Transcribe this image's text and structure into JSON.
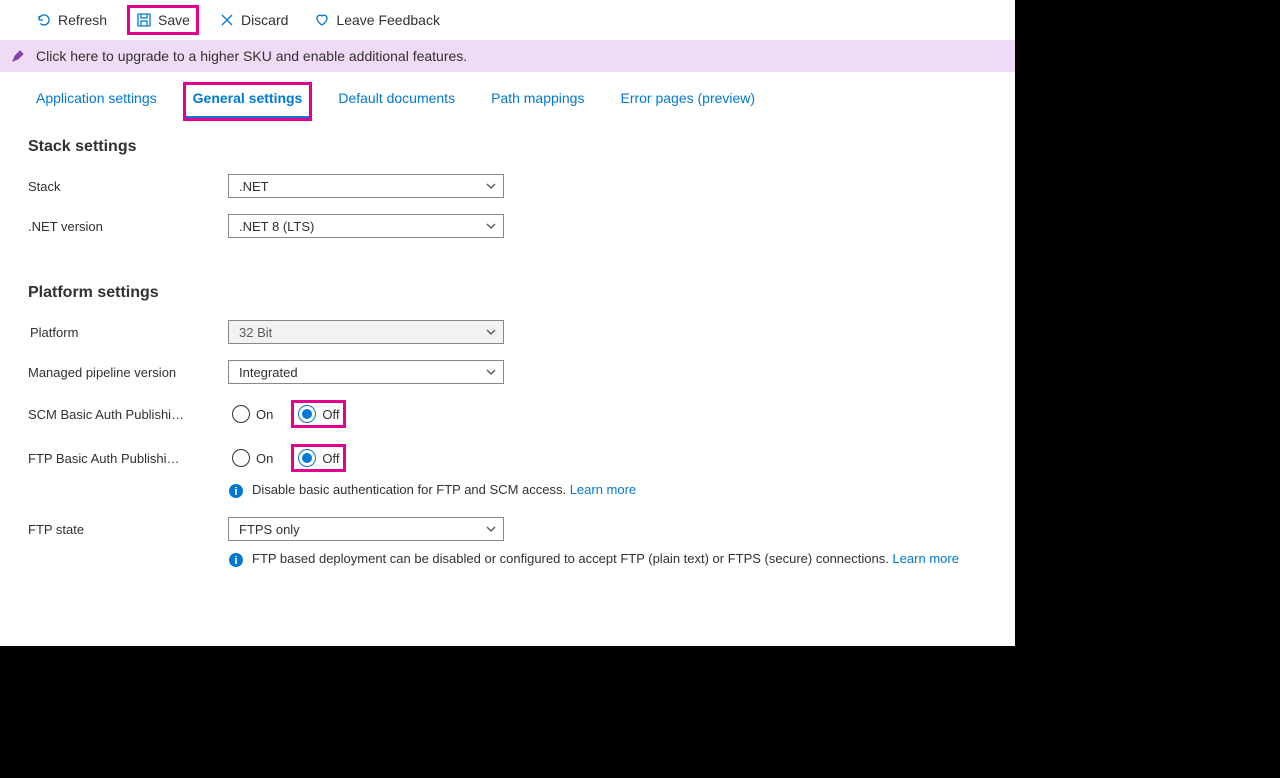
{
  "toolbar": {
    "refresh": "Refresh",
    "save": "Save",
    "discard": "Discard",
    "feedback": "Leave Feedback"
  },
  "banner": {
    "text": "Click here to upgrade to a higher SKU and enable additional features."
  },
  "tabs": {
    "appSettings": "Application settings",
    "general": "General settings",
    "defaultDocs": "Default documents",
    "pathMappings": "Path mappings",
    "errorPages": "Error pages (preview)"
  },
  "stackSettings": {
    "heading": "Stack settings",
    "stackLabel": "Stack",
    "stackValue": ".NET",
    "netVersionLabel": ".NET version",
    "netVersionValue": ".NET 8 (LTS)"
  },
  "platformSettings": {
    "heading": "Platform settings",
    "platformLabel": "Platform",
    "platformValue": "32 Bit",
    "pipelineLabel": "Managed pipeline version",
    "pipelineValue": "Integrated",
    "scmLabel": "SCM Basic Auth Publishi…",
    "ftpLabel": "FTP Basic Auth Publishi…",
    "onLabel": "On",
    "offLabel": "Off",
    "disableBasicAuthText": "Disable basic authentication for FTP and SCM access. ",
    "learnMore": "Learn more",
    "ftpStateLabel": "FTP state",
    "ftpStateValue": "FTPS only",
    "ftpStateHelp": "FTP based deployment can be disabled or configured to accept FTP (plain text) or FTPS (secure) connections. "
  }
}
